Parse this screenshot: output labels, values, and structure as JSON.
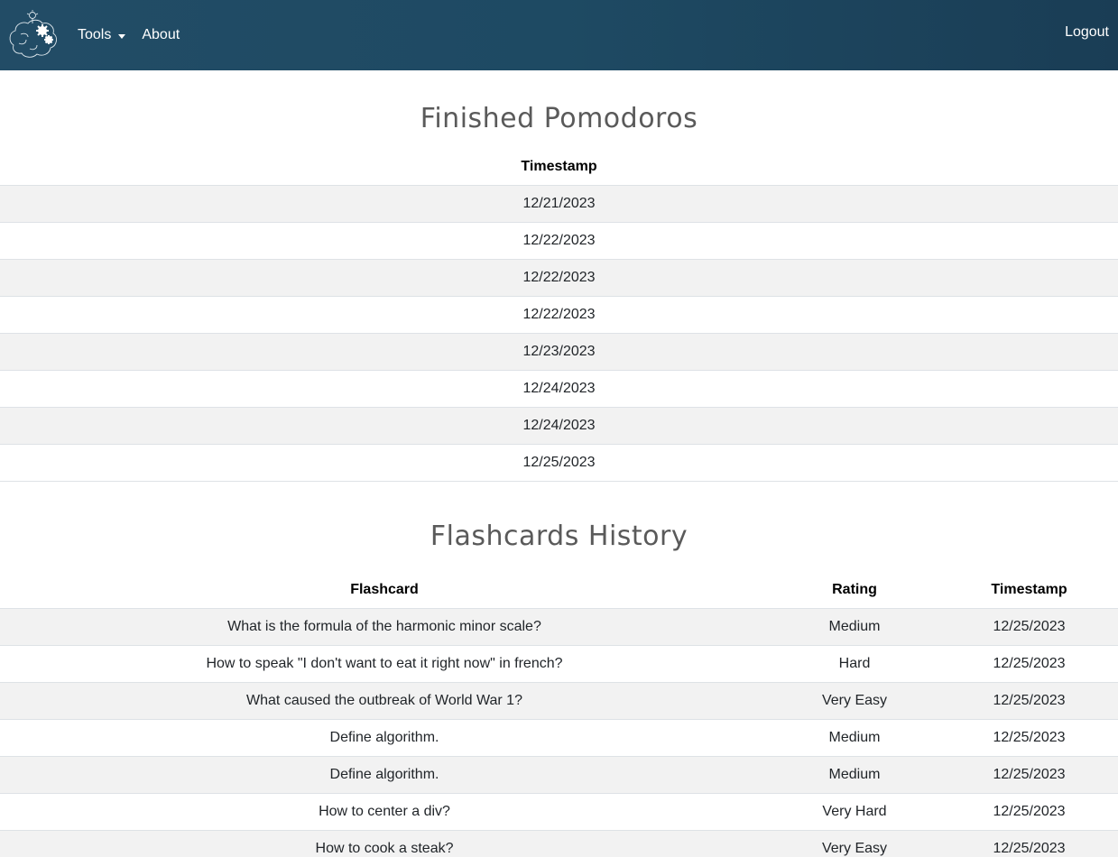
{
  "nav": {
    "logo": "brain-gears-icon",
    "tools_label": "Tools",
    "about_label": "About",
    "logout_label": "Logout"
  },
  "pomodoros": {
    "title": "Finished Pomodoros",
    "header_timestamp": "Timestamp",
    "rows": [
      "12/21/2023",
      "12/22/2023",
      "12/22/2023",
      "12/22/2023",
      "12/23/2023",
      "12/24/2023",
      "12/24/2023",
      "12/25/2023"
    ]
  },
  "flashcards": {
    "title": "Flashcards History",
    "headers": {
      "flashcard": "Flashcard",
      "rating": "Rating",
      "timestamp": "Timestamp"
    },
    "rows": [
      {
        "card": "What is the formula of the harmonic minor scale?",
        "rating": "Medium",
        "timestamp": "12/25/2023"
      },
      {
        "card": "How to speak \"I don't want to eat it right now\" in french?",
        "rating": "Hard",
        "timestamp": "12/25/2023"
      },
      {
        "card": "What caused the outbreak of World War 1?",
        "rating": "Very Easy",
        "timestamp": "12/25/2023"
      },
      {
        "card": "Define algorithm.",
        "rating": "Medium",
        "timestamp": "12/25/2023"
      },
      {
        "card": "Define algorithm.",
        "rating": "Medium",
        "timestamp": "12/25/2023"
      },
      {
        "card": "How to center a div?",
        "rating": "Very Hard",
        "timestamp": "12/25/2023"
      },
      {
        "card": "How to cook a steak?",
        "rating": "Very Easy",
        "timestamp": "12/25/2023"
      }
    ]
  }
}
